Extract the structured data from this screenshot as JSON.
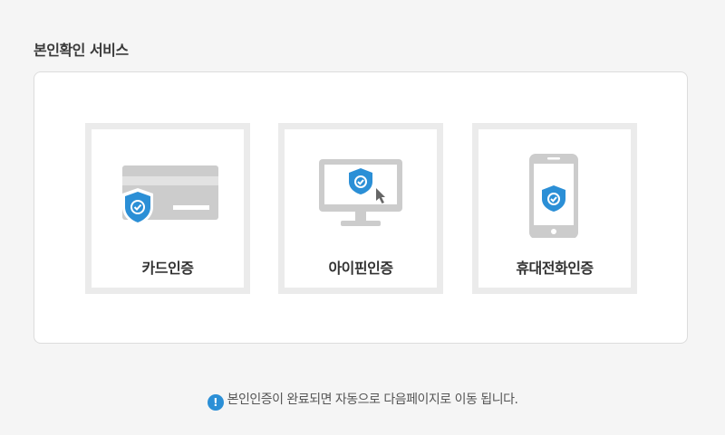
{
  "section": {
    "title": "본인확인 서비스"
  },
  "options": [
    {
      "label": "카드인증",
      "icon": "card-shield-icon"
    },
    {
      "label": "아이핀인증",
      "icon": "monitor-shield-icon"
    },
    {
      "label": "휴대전화인증",
      "icon": "phone-shield-icon"
    }
  ],
  "notice": {
    "icon": "exclamation-circle-icon",
    "text": "본인인증이 완료되면 자동으로 다음페이지로 이동 됩니다."
  },
  "colors": {
    "accent": "#2b8fd6",
    "icon_gray": "#c8c8c8",
    "box_border": "#ebebeb"
  }
}
